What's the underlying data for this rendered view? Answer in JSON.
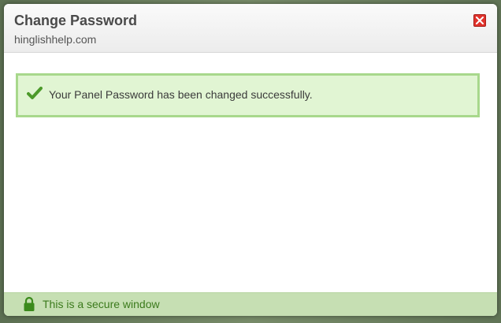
{
  "dialog": {
    "title": "Change Password",
    "subtitle": "hinglishhelp.com",
    "close_icon": "close-icon"
  },
  "alert": {
    "icon": "checkmark-icon",
    "message": "Your Panel Password has been changed successfully.",
    "color": "#e1f5d3"
  },
  "footer": {
    "icon": "lock-icon",
    "text": "This is a secure window",
    "color": "#c6dfb3"
  }
}
